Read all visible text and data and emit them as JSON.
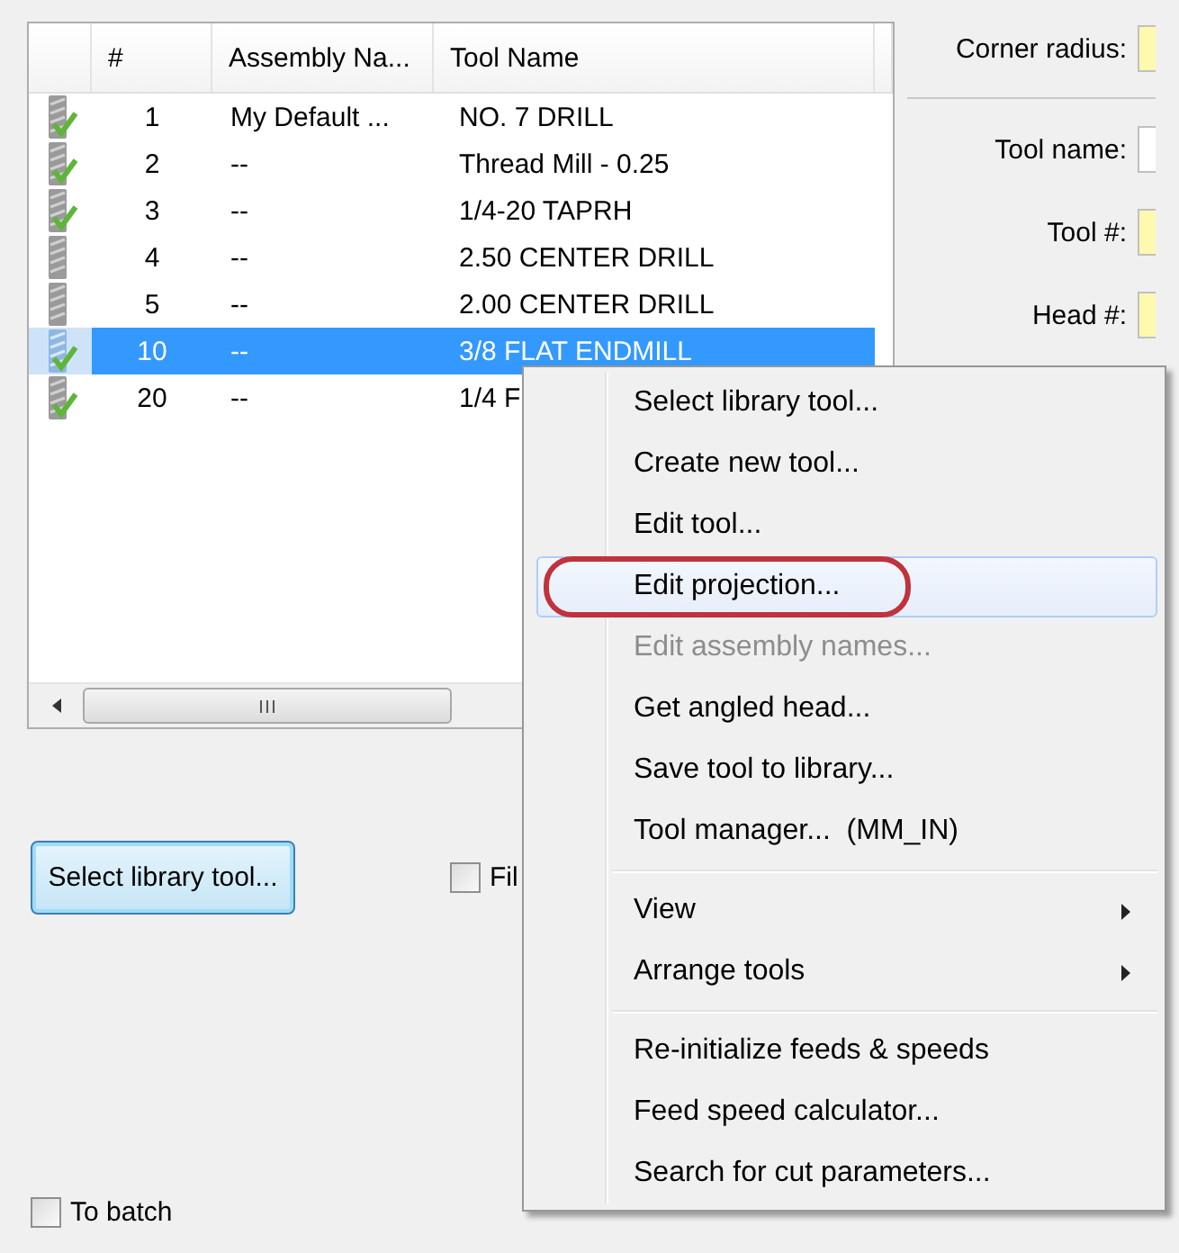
{
  "tool_list": {
    "columns": [
      "#",
      "Assembly Na...",
      "Tool Name"
    ],
    "rows": [
      {
        "number": "1",
        "assembly": "My Default ...",
        "tool_name": "NO. 7 DRILL",
        "checked": true,
        "selected": false
      },
      {
        "number": "2",
        "assembly": "--",
        "tool_name": "Thread Mill - 0.25",
        "checked": true,
        "selected": false
      },
      {
        "number": "3",
        "assembly": "--",
        "tool_name": "1/4-20 TAPRH",
        "checked": true,
        "selected": false
      },
      {
        "number": "4",
        "assembly": "--",
        "tool_name": "2.50 CENTER DRILL",
        "checked": false,
        "selected": false
      },
      {
        "number": "5",
        "assembly": "--",
        "tool_name": "2.00 CENTER DRILL",
        "checked": false,
        "selected": false
      },
      {
        "number": "10",
        "assembly": "--",
        "tool_name": "3/8 FLAT ENDMILL",
        "checked": true,
        "selected": true
      },
      {
        "number": "20",
        "assembly": "--",
        "tool_name": "1/4 F",
        "checked": true,
        "selected": false
      }
    ]
  },
  "right_panel": {
    "fields": [
      {
        "label": "Corner radius:",
        "highlighted": true
      },
      {
        "label": "Tool name:",
        "highlighted": false
      },
      {
        "label": "Tool #:",
        "highlighted": true
      },
      {
        "label": "Head #:",
        "highlighted": true
      }
    ]
  },
  "select_button": "Select library tool...",
  "checkboxes": [
    {
      "label": "Fil",
      "checked": false
    },
    {
      "label": "To batch",
      "checked": false
    }
  ],
  "context_menu": {
    "items": [
      {
        "kind": "item",
        "label": "Select library tool...",
        "disabled": false,
        "hovered": false,
        "circled": false,
        "submenu": false
      },
      {
        "kind": "item",
        "label": "Create new tool...",
        "disabled": false,
        "hovered": false,
        "circled": false,
        "submenu": false
      },
      {
        "kind": "item",
        "label": "Edit tool...",
        "disabled": false,
        "hovered": false,
        "circled": false,
        "submenu": false
      },
      {
        "kind": "item",
        "label": "Edit projection...",
        "disabled": false,
        "hovered": true,
        "circled": true,
        "submenu": false
      },
      {
        "kind": "item",
        "label": "Edit assembly names...",
        "disabled": true,
        "hovered": false,
        "circled": false,
        "submenu": false
      },
      {
        "kind": "item",
        "label": "Get angled head...",
        "disabled": false,
        "hovered": false,
        "circled": false,
        "submenu": false
      },
      {
        "kind": "item",
        "label": "Save tool to library...",
        "disabled": false,
        "hovered": false,
        "circled": false,
        "submenu": false
      },
      {
        "kind": "item",
        "label": "Tool manager...  (MM_IN)",
        "disabled": false,
        "hovered": false,
        "circled": false,
        "submenu": false
      },
      {
        "kind": "separator"
      },
      {
        "kind": "item",
        "label": "View",
        "disabled": false,
        "hovered": false,
        "circled": false,
        "submenu": true
      },
      {
        "kind": "item",
        "label": "Arrange tools",
        "disabled": false,
        "hovered": false,
        "circled": false,
        "submenu": true
      },
      {
        "kind": "separator"
      },
      {
        "kind": "item",
        "label": "Re-initialize feeds & speeds",
        "disabled": false,
        "hovered": false,
        "circled": false,
        "submenu": false
      },
      {
        "kind": "item",
        "label": "Feed speed calculator...",
        "disabled": false,
        "hovered": false,
        "circled": false,
        "submenu": false
      },
      {
        "kind": "item",
        "label": "Search for cut parameters...",
        "disabled": false,
        "hovered": false,
        "circled": false,
        "submenu": false
      }
    ]
  }
}
